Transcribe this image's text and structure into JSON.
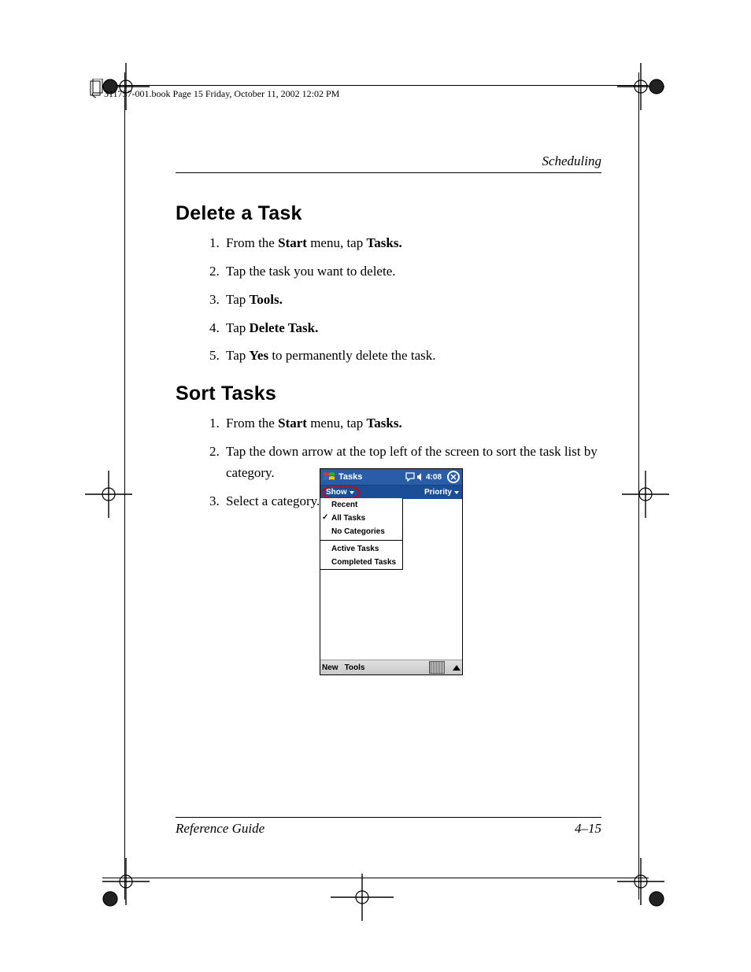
{
  "book_mark": "311757-001.book  Page 15  Friday, October 11, 2002  12:02 PM",
  "running_head": "Scheduling",
  "sections": {
    "delete": {
      "title": "Delete a Task",
      "steps": [
        {
          "pre": "From the ",
          "b1": "Start",
          "mid": " menu, tap ",
          "b2": "Tasks.",
          "post": ""
        },
        {
          "pre": "Tap the task you want to delete.",
          "b1": "",
          "mid": "",
          "b2": "",
          "post": ""
        },
        {
          "pre": "Tap ",
          "b1": "Tools.",
          "mid": "",
          "b2": "",
          "post": ""
        },
        {
          "pre": "Tap ",
          "b1": "Delete Task.",
          "mid": "",
          "b2": "",
          "post": ""
        },
        {
          "pre": "Tap ",
          "b1": "Yes",
          "mid": " to permanently delete the task.",
          "b2": "",
          "post": ""
        }
      ]
    },
    "sort": {
      "title": "Sort Tasks",
      "steps": [
        {
          "pre": "From the ",
          "b1": "Start",
          "mid": " menu, tap ",
          "b2": "Tasks.",
          "post": ""
        },
        {
          "pre": "Tap the down arrow at the top left of the screen to sort the task list by category.",
          "b1": "",
          "mid": "",
          "b2": "",
          "post": ""
        },
        {
          "pre": "Select a category.",
          "b1": "",
          "mid": "",
          "b2": "",
          "post": ""
        }
      ]
    }
  },
  "ppc": {
    "title": "Tasks",
    "time": "4:08",
    "cmdbar_left": "Show",
    "cmdbar_left_dropdown": "▾",
    "cmdbar_right": "Priority",
    "menu": [
      {
        "label": "Recent",
        "checked": false
      },
      {
        "label": "All Tasks",
        "checked": true
      },
      {
        "label": "No Categories",
        "checked": false
      },
      {
        "sep": true
      },
      {
        "label": "Active Tasks",
        "checked": false
      },
      {
        "label": "Completed Tasks",
        "checked": false
      }
    ],
    "bottom_left_1": "New",
    "bottom_left_2": "Tools"
  },
  "footer": {
    "left": "Reference Guide",
    "right": "4–15"
  }
}
